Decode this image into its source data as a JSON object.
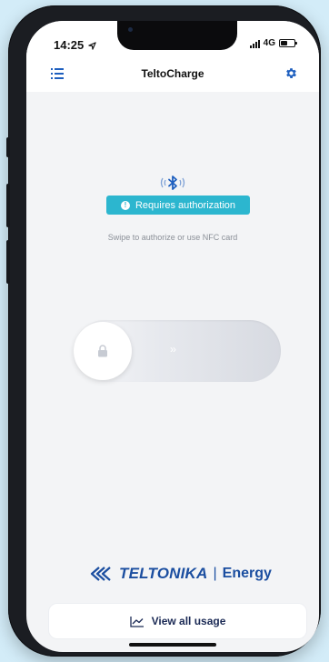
{
  "status_bar": {
    "time": "14:25",
    "network": "4G"
  },
  "header": {
    "title": "TeltoCharge"
  },
  "auth": {
    "badge_text": "Requires authorization",
    "hint": "Swipe to authorize or use NFC card"
  },
  "slider": {
    "chevrons": "››"
  },
  "brand": {
    "name": "TELTONIKA",
    "separator": "|",
    "sub": "Energy"
  },
  "footer": {
    "usage_label": "View all usage"
  },
  "colors": {
    "accent": "#1e5fbf",
    "badge": "#2cb6cf",
    "brand": "#1b4ea0"
  }
}
